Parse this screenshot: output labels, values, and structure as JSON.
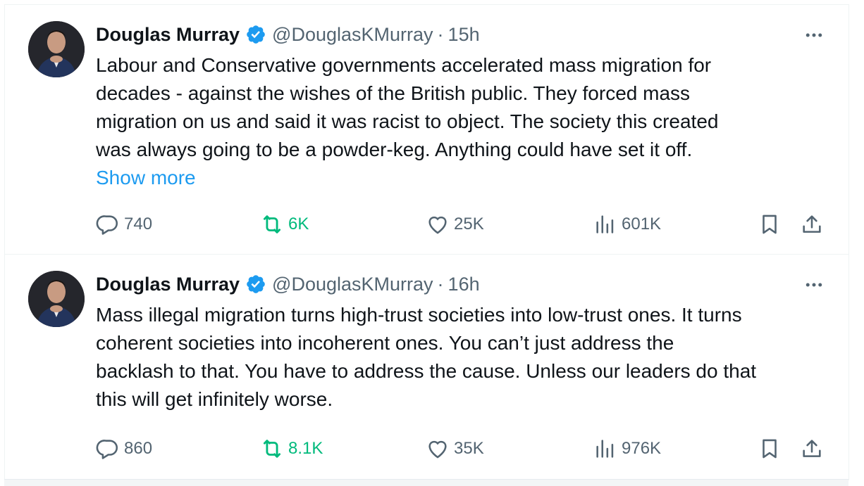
{
  "colors": {
    "text_primary": "#0f1419",
    "text_secondary": "#536471",
    "link": "#1d9bf0",
    "retweet_active": "#00ba7c",
    "verified": "#1d9bf0"
  },
  "tweets": [
    {
      "author_name": "Douglas Murray",
      "handle": "@DouglasKMurray",
      "separator": "·",
      "time": "15h",
      "text_lines": [
        "Labour and Conservative governments accelerated mass migration for",
        "decades - against the wishes of the British public. They forced mass",
        "migration on us and said it was racist to object. The society this created",
        "was always going to be a powder-keg. Anything could have set it off."
      ],
      "show_more": "Show more",
      "replies": "740",
      "retweets": "6K",
      "likes": "25K",
      "views": "601K"
    },
    {
      "author_name": "Douglas Murray",
      "handle": "@DouglasKMurray",
      "separator": "·",
      "time": "16h",
      "text_lines": [
        "Mass illegal migration turns high-trust societies into low-trust ones. It turns",
        "coherent societies into incoherent ones. You can’t just address the",
        "backlash to that. You have to address the cause. Unless our leaders do that",
        "this will get infinitely worse."
      ],
      "replies": "860",
      "retweets": "8.1K",
      "likes": "35K",
      "views": "976K"
    }
  ]
}
